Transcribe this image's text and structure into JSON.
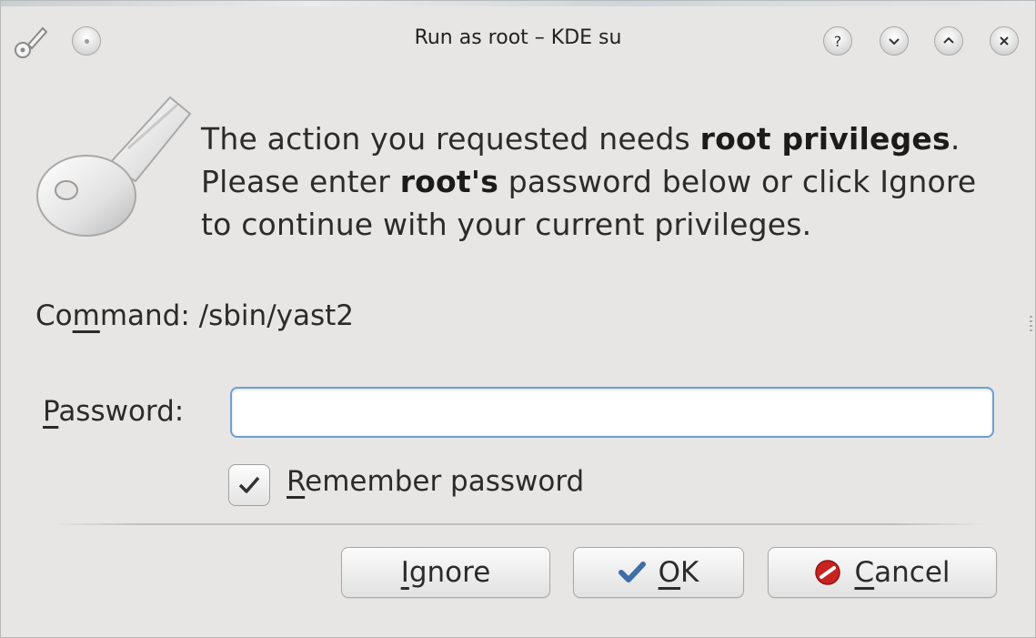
{
  "window": {
    "title": "Run as root – KDE su",
    "titlebar_icons": [
      "key-icon",
      "window-menu-icon",
      "help-icon",
      "minimize-icon",
      "maximize-icon",
      "close-icon"
    ],
    "help_glyph": "?"
  },
  "message": {
    "part1": "The action you requested needs ",
    "bold1": "root privileges",
    "part2": ".",
    "part3": "Please enter ",
    "bold2": "root's",
    "part4": " password below or click Ignore",
    "part5": "to continue with your current privileges."
  },
  "command": {
    "label_pre": "Co",
    "label_mnemonic": "m",
    "label_post": "mand:",
    "value": "/sbin/yast2"
  },
  "password": {
    "label_mnemonic": "P",
    "label_post": "assword:",
    "value": "",
    "placeholder": ""
  },
  "remember": {
    "checked": true,
    "label_mnemonic": "R",
    "label_post": "emember password"
  },
  "buttons": {
    "ignore": {
      "mnemonic": "I",
      "post": "gnore"
    },
    "ok": {
      "mnemonic": "O",
      "post": "K"
    },
    "cancel": {
      "mnemonic": "C",
      "post": "ancel"
    }
  },
  "colors": {
    "window_bg": "#e7e6e4",
    "input_focus_border": "#6f9fd6",
    "ok_check": "#3f6ea8",
    "cancel_icon": "#c8231f"
  }
}
